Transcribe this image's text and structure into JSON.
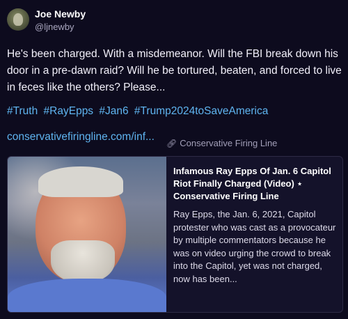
{
  "author": {
    "display_name": "Joe Newby",
    "handle": "@ljnewby"
  },
  "post": {
    "text": "He's been charged.  With a misdemeanor.  Will the FBI break down his door in a pre-dawn raid?  Will he be tortured, beaten, and forced to live in feces like the others?  Please...",
    "hashtags": [
      "#Truth",
      "#RayEpps",
      "#Jan6",
      "#Trump2024toSaveAmerica"
    ],
    "link_text": "conservativefiringline.com/inf..."
  },
  "card": {
    "title": "Infamous Ray Epps Of Jan. 6 Capitol Riot Finally Charged (Video) ⋆ Conservative Firing Line",
    "description": "Ray Epps, the Jan. 6, 2021, Capitol protester who was cast as a provocateur by multiple commentators because he was on video urging the crowd to break into the Capitol, yet was not charged, now has been...",
    "source": "Conservative Firing Line",
    "link_icon": "link-icon"
  },
  "colors": {
    "background": "#0d0b1e",
    "link": "#5fb4f0",
    "card_border": "#2d2a45"
  }
}
